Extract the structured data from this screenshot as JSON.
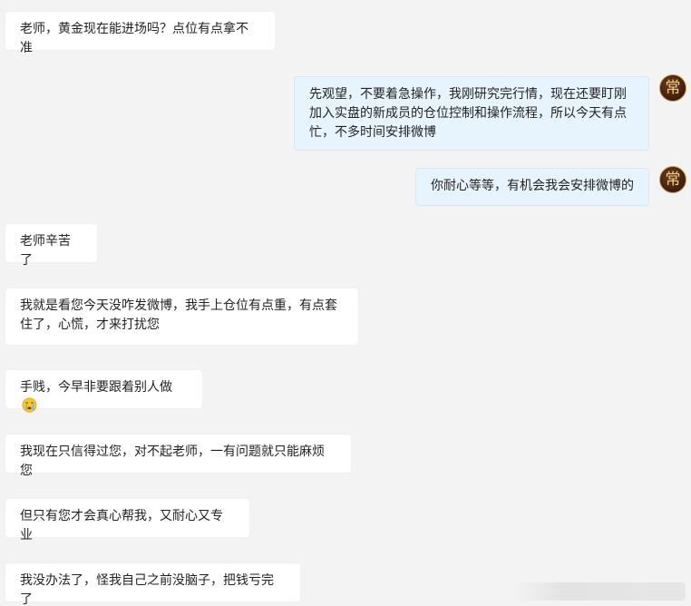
{
  "conversation": {
    "messages": [
      {
        "side": "in",
        "text": "老师，黄金现在能进场吗？点位有点拿不准"
      },
      {
        "side": "out",
        "text": "先观望，不要着急操作，我刚研究完行情，现在还要盯刚加入实盘的新成员的仓位控制和操作流程，所以今天有点忙，不多时间安排微博"
      },
      {
        "side": "out",
        "text": "你耐心等等，有机会我会安排微博的"
      },
      {
        "side": "in",
        "text": "老师辛苦了"
      },
      {
        "side": "in",
        "text": "我就是看您今天没咋发微博，我手上仓位有点重，有点套住了，心慌，才来打扰您"
      },
      {
        "side": "in",
        "text": "手贱，今早非要跟着别人做"
      },
      {
        "side": "in",
        "text": "我现在只信得过您，对不起老师，一有问题就只能麻烦您"
      },
      {
        "side": "in",
        "text": "但只有您才会真心帮我，又耐心又专业"
      },
      {
        "side": "in",
        "text": "我没办法了，怪我自己之前没脑子，把钱亏完了"
      }
    ],
    "avatar_glyph": "常",
    "emoji": "crying-face-icon"
  }
}
